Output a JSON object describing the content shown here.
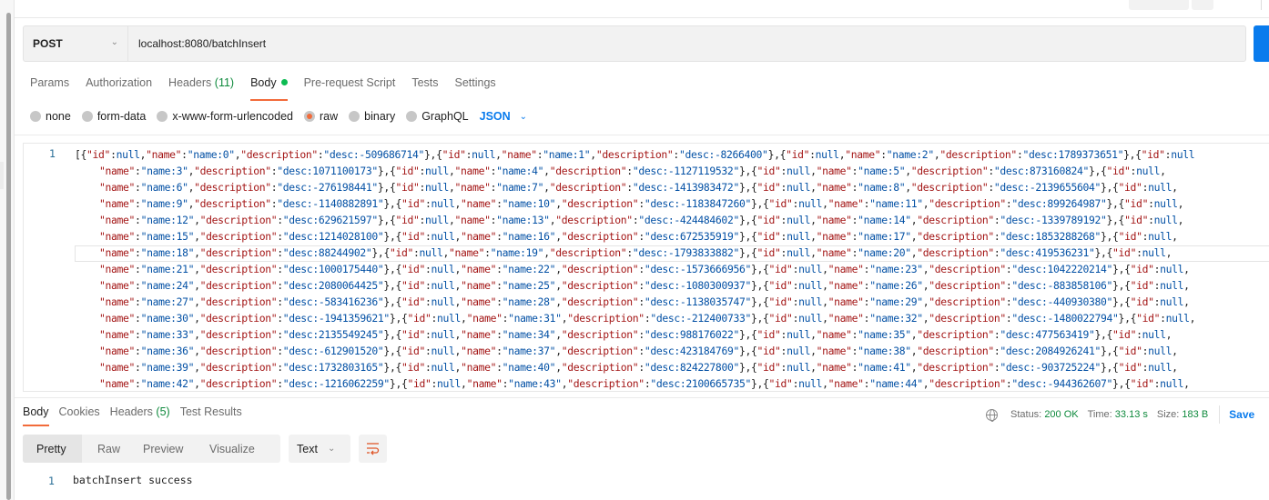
{
  "request": {
    "method": "POST",
    "url": "localhost:8080/batchInsert",
    "tabs": [
      {
        "label": "Params"
      },
      {
        "label": "Authorization"
      },
      {
        "label": "Headers",
        "count": "(11)"
      },
      {
        "label": "Body",
        "active": true
      },
      {
        "label": "Pre-request Script"
      },
      {
        "label": "Tests"
      },
      {
        "label": "Settings"
      }
    ],
    "body_types": [
      {
        "label": "none"
      },
      {
        "label": "form-data"
      },
      {
        "label": "x-www-form-urlencoded"
      },
      {
        "label": "raw",
        "selected": true
      },
      {
        "label": "binary"
      },
      {
        "label": "GraphQL"
      }
    ],
    "raw_language": "JSON",
    "editor": {
      "line_number": "1",
      "records": [
        {
          "name": "name:0",
          "description": "desc:-509686714"
        },
        {
          "name": "name:1",
          "description": "desc:-8266400"
        },
        {
          "name": "name:2",
          "description": "desc:1789373651"
        },
        {
          "name": "name:3",
          "description": "desc:1071100173"
        },
        {
          "name": "name:4",
          "description": "desc:-1127119532"
        },
        {
          "name": "name:5",
          "description": "desc:873160824"
        },
        {
          "name": "name:6",
          "description": "desc:-276198441"
        },
        {
          "name": "name:7",
          "description": "desc:-1413983472"
        },
        {
          "name": "name:8",
          "description": "desc:-2139655604"
        },
        {
          "name": "name:9",
          "description": "desc:-1140882891"
        },
        {
          "name": "name:10",
          "description": "desc:-1183847260"
        },
        {
          "name": "name:11",
          "description": "desc:899264987"
        },
        {
          "name": "name:12",
          "description": "desc:629621597"
        },
        {
          "name": "name:13",
          "description": "desc:-424484602"
        },
        {
          "name": "name:14",
          "description": "desc:-1339789192"
        },
        {
          "name": "name:15",
          "description": "desc:1214028100"
        },
        {
          "name": "name:16",
          "description": "desc:672535919"
        },
        {
          "name": "name:17",
          "description": "desc:1853288268"
        },
        {
          "name": "name:18",
          "description": "desc:88244902"
        },
        {
          "name": "name:19",
          "description": "desc:-1793833882"
        },
        {
          "name": "name:20",
          "description": "desc:419536231"
        },
        {
          "name": "name:21",
          "description": "desc:1000175440"
        },
        {
          "name": "name:22",
          "description": "desc:-1573666956"
        },
        {
          "name": "name:23",
          "description": "desc:1042220214"
        },
        {
          "name": "name:24",
          "description": "desc:2080064425"
        },
        {
          "name": "name:25",
          "description": "desc:-1080300937"
        },
        {
          "name": "name:26",
          "description": "desc:-883858106"
        },
        {
          "name": "name:27",
          "description": "desc:-583416236"
        },
        {
          "name": "name:28",
          "description": "desc:-1138035747"
        },
        {
          "name": "name:29",
          "description": "desc:-440930380"
        },
        {
          "name": "name:30",
          "description": "desc:-1941359621"
        },
        {
          "name": "name:31",
          "description": "desc:-212400733"
        },
        {
          "name": "name:32",
          "description": "desc:-1480022794"
        },
        {
          "name": "name:33",
          "description": "desc:2135549245"
        },
        {
          "name": "name:34",
          "description": "desc:988176022"
        },
        {
          "name": "name:35",
          "description": "desc:477563419"
        },
        {
          "name": "name:36",
          "description": "desc:-612901520"
        },
        {
          "name": "name:37",
          "description": "desc:423184769"
        },
        {
          "name": "name:38",
          "description": "desc:2084926241"
        },
        {
          "name": "name:39",
          "description": "desc:1732803165"
        },
        {
          "name": "name:40",
          "description": "desc:824227800"
        },
        {
          "name": "name:41",
          "description": "desc:-903725224"
        },
        {
          "name": "name:42",
          "description": "desc:-1216062259"
        },
        {
          "name": "name:43",
          "description": "desc:2100665735"
        },
        {
          "name": "name:44",
          "description": "desc:-944362607"
        }
      ]
    }
  },
  "response": {
    "tabs": [
      {
        "label": "Body",
        "active": true
      },
      {
        "label": "Cookies"
      },
      {
        "label": "Headers",
        "count": "(5)"
      },
      {
        "label": "Test Results"
      }
    ],
    "status_label": "Status:",
    "status_value": "200 OK",
    "time_label": "Time:",
    "time_value": "33.13 s",
    "size_label": "Size:",
    "size_value": "183 B",
    "save_label": "Save",
    "view_modes": [
      "Pretty",
      "Raw",
      "Preview",
      "Visualize"
    ],
    "format": "Text",
    "line_number": "1",
    "body_text": "batchInsert success"
  },
  "colors": {
    "accent_orange": "#f26b3a",
    "primary_blue": "#097bed",
    "success_green": "#0f8a3d",
    "json_key": "#a31515",
    "json_value": "#0451a5"
  }
}
